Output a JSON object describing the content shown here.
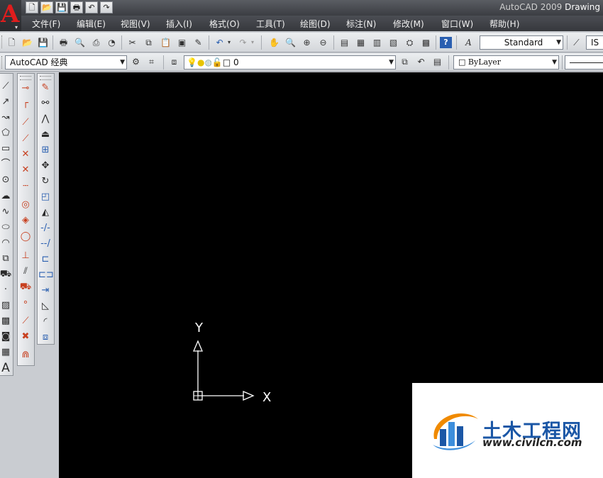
{
  "window": {
    "title_app": "AutoCAD 2009",
    "title_doc": "Drawing"
  },
  "app_logo": {
    "letter": "A",
    "menu_arrow": "▾"
  },
  "quick_access": [
    {
      "icon": "new-icon",
      "glyph": "🗋"
    },
    {
      "icon": "open-icon",
      "glyph": "📂"
    },
    {
      "icon": "save-icon",
      "glyph": "💾"
    },
    {
      "icon": "print-icon",
      "glyph": "🖶"
    },
    {
      "icon": "undo-icon",
      "glyph": "↶"
    },
    {
      "icon": "redo-icon",
      "glyph": "↷"
    }
  ],
  "menu": [
    "文件(F)",
    "编辑(E)",
    "视图(V)",
    "插入(I)",
    "格式(O)",
    "工具(T)",
    "绘图(D)",
    "标注(N)",
    "修改(M)",
    "窗口(W)",
    "帮助(H)"
  ],
  "toolbar1": {
    "text_style": "Standard",
    "dim_style": "IS"
  },
  "toolbar2": {
    "workspace": "AutoCAD 经典",
    "layer": "0",
    "color": "ByLayer"
  },
  "ucs": {
    "x_label": "X",
    "y_label": "Y"
  },
  "watermark": {
    "name": "土木工程网",
    "url": "www.civilcn.com"
  },
  "colors": {
    "canvas": "#000000",
    "accent_red": "#e01d1d",
    "watermark_blue": "#1b57a6"
  }
}
